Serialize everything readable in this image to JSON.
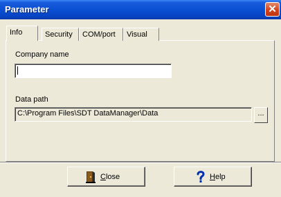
{
  "window": {
    "title": "Parameter",
    "close_glyph": "✕"
  },
  "tabs": [
    {
      "label": "Info",
      "active": true
    },
    {
      "label": "Security",
      "active": false
    },
    {
      "label": "COM/port",
      "active": false
    },
    {
      "label": "Visual",
      "active": false
    }
  ],
  "form": {
    "company_name_label": "Company name",
    "company_name_value": "",
    "data_path_label": "Data path",
    "data_path_value": "C:\\Program Files\\SDT DataManager\\Data",
    "browse_label": "..."
  },
  "buttons": {
    "close_mnemonic": "C",
    "close_rest": "lose",
    "close_icon": "door-exit-icon",
    "help_mnemonic": "H",
    "help_rest": "elp",
    "help_icon": "question-mark-icon"
  },
  "colors": {
    "titlebar": "#0a4fd3",
    "face": "#ece9d8",
    "help_icon": "#0030b0",
    "close_icon": "#5b3a12"
  }
}
